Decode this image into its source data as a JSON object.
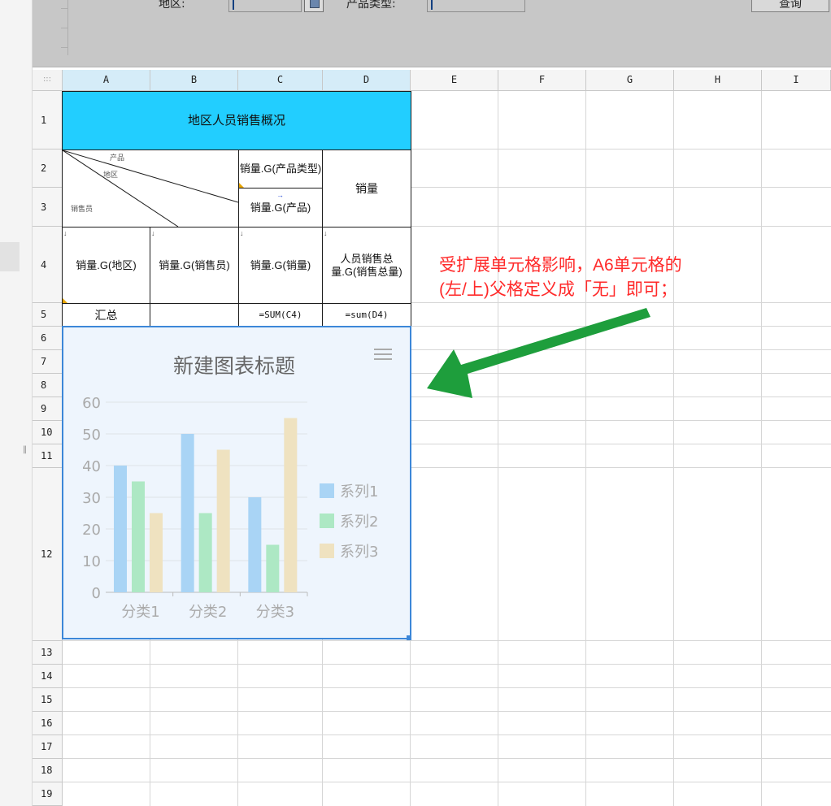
{
  "param_panel": {
    "region_label": "地区:",
    "product_type_label": "产品类型:",
    "query_button": "查询"
  },
  "grid": {
    "columns": [
      "A",
      "B",
      "C",
      "D",
      "E",
      "F",
      "G",
      "H",
      "I"
    ],
    "rows": [
      "1",
      "2",
      "3",
      "4",
      "5",
      "6",
      "7",
      "8",
      "9",
      "10",
      "11",
      "12",
      "13",
      "14",
      "15",
      "16",
      "17",
      "18",
      "19"
    ],
    "corner_glyph": ":::"
  },
  "cells": {
    "title": "地区人员销售概况",
    "header_product": "产品",
    "header_region": "地区",
    "header_salesperson": "销售员",
    "c2": "销量.G(产品类型)",
    "c3": "销量.G(产品)",
    "d23": "销量",
    "a4": "销量.G(地区)",
    "b4": "销量.G(销售员)",
    "c4": "销量.G(销量)",
    "d4": "人员销售总量.G(销售总量)",
    "a5": "汇总",
    "c5": "=SUM(C4)",
    "d5": "=sum(D4)"
  },
  "chart_data": {
    "type": "bar",
    "title": "新建图表标题",
    "categories": [
      "分类1",
      "分类2",
      "分类3"
    ],
    "series": [
      {
        "name": "系列1",
        "values": [
          40,
          50,
          30
        ],
        "color": "#a9d4f5"
      },
      {
        "name": "系列2",
        "values": [
          35,
          25,
          15
        ],
        "color": "#ade8c4"
      },
      {
        "name": "系列3",
        "values": [
          25,
          45,
          55
        ],
        "color": "#efe2c0"
      }
    ],
    "ylim": [
      0,
      60
    ],
    "yticks": [
      "0",
      "10",
      "20",
      "30",
      "40",
      "50",
      "60"
    ],
    "legend_position": "right",
    "grid": true,
    "menu_icon": "menu-icon"
  },
  "annotation": {
    "line1": "受扩展单元格影响，A6单元格的",
    "line2": "(左/上)父格定义成「无」即可；",
    "arrow_color": "#1e9e3c",
    "text_color": "#ff2a2a"
  },
  "colors": {
    "title_fill": "#22ceff",
    "selected_header": "#d5ecf8",
    "chart_border": "#3c87d8"
  }
}
